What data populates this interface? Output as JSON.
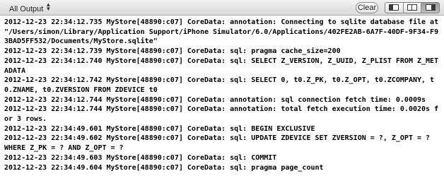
{
  "toolbar": {
    "scope_label": "All Output",
    "scope_stepper_up": "▲",
    "scope_stepper_down": "▼",
    "clear_label": "Clear",
    "view_modes": [
      {
        "icon": "left-pane-icon",
        "selected": false
      },
      {
        "icon": "split-pane-icon",
        "selected": false
      },
      {
        "icon": "right-pane-icon",
        "selected": true
      }
    ]
  },
  "console": {
    "lines": [
      "2012-12-23 22:34:12.735 MyStore[48890:c07] CoreData: annotation: Connecting to sqlite database file at \"/Users/simon/Library/Application Support/iPhone Simulator/6.0/Applications/402FE2AB-6A7F-40DF-9F34-F93BAD5FF532/Documents/MyStore.sqlite\"",
      "2012-12-23 22:34:12.739 MyStore[48890:c07] CoreData: sql: pragma cache_size=200",
      "2012-12-23 22:34:12.740 MyStore[48890:c07] CoreData: sql: SELECT Z_VERSION, Z_UUID, Z_PLIST FROM Z_METADATA",
      "2012-12-23 22:34:12.742 MyStore[48890:c07] CoreData: sql: SELECT 0, t0.Z_PK, t0.Z_OPT, t0.ZCOMPANY, t0.ZNAME, t0.ZVERSION FROM ZDEVICE t0",
      "2012-12-23 22:34:12.744 MyStore[48890:c07] CoreData: annotation: sql connection fetch time: 0.0009s",
      "2012-12-23 22:34:12.744 MyStore[48890:c07] CoreData: annotation: total fetch execution time: 0.0020s for 3 rows.",
      "2012-12-23 22:34:49.601 MyStore[48890:c07] CoreData: sql: BEGIN EXCLUSIVE",
      "2012-12-23 22:34:49.602 MyStore[48890:c07] CoreData: sql: UPDATE ZDEVICE SET ZVERSION = ?, Z_OPT = ?  WHERE Z_PK = ? AND Z_OPT = ?",
      "2012-12-23 22:34:49.603 MyStore[48890:c07] CoreData: sql: COMMIT",
      "2012-12-23 22:34:49.604 MyStore[48890:c07] CoreData: sql: pragma page_count"
    ]
  }
}
